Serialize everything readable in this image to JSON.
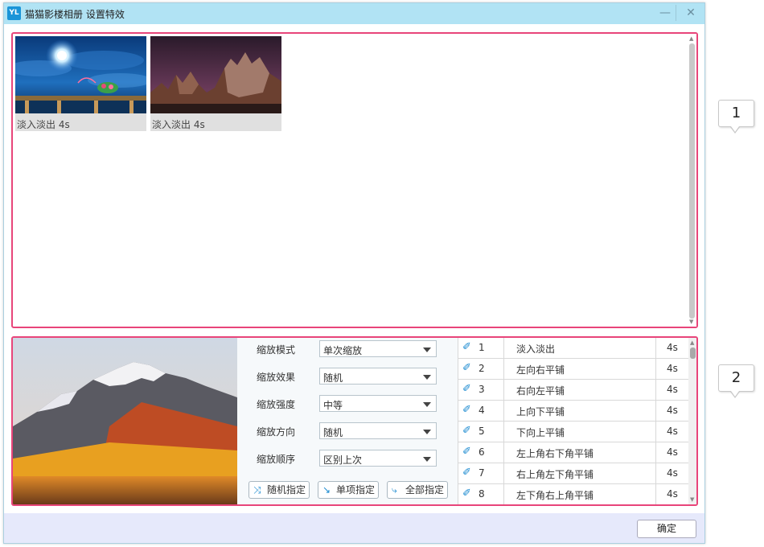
{
  "window": {
    "app_icon": "YL",
    "title": "猫猫影楼相册 设置特效",
    "minimize_icon": "minimize-icon",
    "close_icon": "close-icon"
  },
  "thumbnails": [
    {
      "caption": "淡入淡出 4s",
      "image": "moonlit-night-sky"
    },
    {
      "caption": "淡入淡出 4s",
      "image": "rocky-peaks-dusk"
    }
  ],
  "preview": {
    "image": "mountain-lake-autumn"
  },
  "settings": [
    {
      "label": "缩放模式",
      "value": "单次缩放"
    },
    {
      "label": "缩放效果",
      "value": "随机"
    },
    {
      "label": "缩放强度",
      "value": "中等"
    },
    {
      "label": "缩放方向",
      "value": "随机"
    },
    {
      "label": "缩放顺序",
      "value": "区别上次"
    }
  ],
  "actions": [
    {
      "label": "随机指定",
      "icon": "shuffle-icon"
    },
    {
      "label": "单项指定",
      "icon": "curve-arrow-icon"
    },
    {
      "label": "全部指定",
      "icon": "curve-arrow-icon"
    }
  ],
  "effects": [
    {
      "num": "1",
      "name": "淡入淡出",
      "duration": "4s"
    },
    {
      "num": "2",
      "name": "左向右平铺",
      "duration": "4s"
    },
    {
      "num": "3",
      "name": "右向左平铺",
      "duration": "4s"
    },
    {
      "num": "4",
      "name": "上向下平铺",
      "duration": "4s"
    },
    {
      "num": "5",
      "name": "下向上平铺",
      "duration": "4s"
    },
    {
      "num": "6",
      "name": "左上角右下角平铺",
      "duration": "4s"
    },
    {
      "num": "7",
      "name": "右上角左下角平铺",
      "duration": "4s"
    },
    {
      "num": "8",
      "name": "左下角右上角平铺",
      "duration": "4s"
    }
  ],
  "ok_label": "确定",
  "callouts": [
    "1",
    "2"
  ],
  "colors": {
    "accent": "#e8457a",
    "titlebar": "#b1e3f4",
    "footer": "#e6e9fb",
    "icon_blue": "#1a8ad0"
  }
}
